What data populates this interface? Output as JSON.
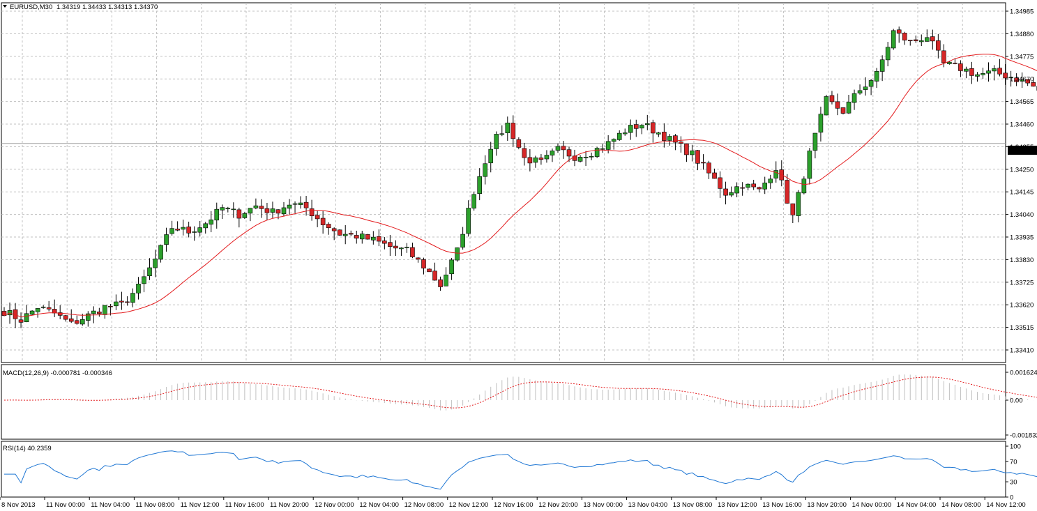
{
  "colors": {
    "background": "#ffffff",
    "grid": "#c0c0c0",
    "frame": "#000000",
    "bull_candle": "#2ca02c",
    "bear_candle": "#d62728",
    "wick": "#000000",
    "ma_line": "#e31a1c",
    "macd_hist": "#c0c0c0",
    "macd_signal": "#e31a1c",
    "rsi_line": "#1f77d4",
    "price_tag_bg": "#000000",
    "price_tag_text": "#ffffff"
  },
  "header": {
    "symbol": "EURUSD,M30",
    "ohlc": "1.34319 1.34433 1.34313 1.34370",
    "dropdown_icon": "triangle-down-icon"
  },
  "current_price_label": "1.34370",
  "chart_data": [
    {
      "type": "candlestick",
      "title": "EURUSD,M30",
      "ylim": [
        1.3341,
        1.34985
      ],
      "ytick_labels": [
        "1.34985",
        "1.34880",
        "1.34775",
        "1.34670",
        "1.34565",
        "1.34460",
        "1.34355",
        "1.34250",
        "1.34145",
        "1.34040",
        "1.33935",
        "1.33830",
        "1.33725",
        "1.33620",
        "1.33515",
        "1.33410"
      ],
      "current_price": 1.3437,
      "moving_average": "red overlay line",
      "grid": true
    },
    {
      "type": "bar",
      "title": "MACD(12,26,9) -0.000781 -0.000346",
      "ylim": [
        -0.001832,
        0.001624
      ],
      "ytick_labels": [
        "0.001624",
        "0.00",
        "-0.001832"
      ],
      "series": [
        {
          "kind": "histogram"
        },
        {
          "kind": "signal-dotted-line"
        }
      ]
    },
    {
      "type": "line",
      "title": "RSI(14) 40.2359",
      "ylim": [
        0,
        100
      ],
      "ytick_labels": [
        "100",
        "70",
        "30",
        "0"
      ],
      "levels": [
        70,
        30
      ]
    }
  ],
  "time_axis": {
    "labels": [
      "8 Nov 2013",
      "11 Nov 00:00",
      "11 Nov 04:00",
      "11 Nov 08:00",
      "11 Nov 12:00",
      "11 Nov 16:00",
      "11 Nov 20:00",
      "12 Nov 00:00",
      "12 Nov 04:00",
      "12 Nov 08:00",
      "12 Nov 12:00",
      "12 Nov 16:00",
      "12 Nov 20:00",
      "13 Nov 00:00",
      "13 Nov 04:00",
      "13 Nov 08:00",
      "13 Nov 12:00",
      "13 Nov 16:00",
      "13 Nov 20:00",
      "14 Nov 00:00",
      "14 Nov 04:00",
      "14 Nov 08:00",
      "14 Nov 12:00"
    ]
  },
  "price_anchors": [
    [
      0,
      1.3359
    ],
    [
      3,
      1.3355
    ],
    [
      6,
      1.3361
    ],
    [
      9,
      1.3358
    ],
    [
      12,
      1.3353
    ],
    [
      15,
      1.3357
    ],
    [
      18,
      1.3361
    ],
    [
      21,
      1.3362
    ],
    [
      24,
      1.337
    ],
    [
      27,
      1.3383
    ],
    [
      30,
      1.3398
    ],
    [
      33,
      1.3396
    ],
    [
      36,
      1.34
    ],
    [
      39,
      1.3407
    ],
    [
      42,
      1.3404
    ],
    [
      45,
      1.3408
    ],
    [
      48,
      1.3405
    ],
    [
      51,
      1.3409
    ],
    [
      54,
      1.3407
    ],
    [
      57,
      1.34
    ],
    [
      60,
      1.3395
    ],
    [
      63,
      1.3394
    ],
    [
      66,
      1.3392
    ],
    [
      69,
      1.3389
    ],
    [
      72,
      1.3387
    ],
    [
      75,
      1.338
    ],
    [
      78,
      1.3371
    ],
    [
      81,
      1.3387
    ],
    [
      84,
      1.3415
    ],
    [
      87,
      1.3436
    ],
    [
      90,
      1.3446
    ],
    [
      93,
      1.343
    ],
    [
      96,
      1.3428
    ],
    [
      99,
      1.3434
    ],
    [
      102,
      1.3431
    ],
    [
      105,
      1.3433
    ],
    [
      108,
      1.3437
    ],
    [
      111,
      1.3443
    ],
    [
      114,
      1.3446
    ],
    [
      117,
      1.3442
    ],
    [
      120,
      1.3437
    ],
    [
      123,
      1.3432
    ],
    [
      126,
      1.3423
    ],
    [
      129,
      1.3414
    ],
    [
      132,
      1.3418
    ],
    [
      135,
      1.3415
    ],
    [
      138,
      1.3426
    ],
    [
      141,
      1.3403
    ],
    [
      144,
      1.3432
    ],
    [
      147,
      1.3457
    ],
    [
      150,
      1.3452
    ],
    [
      153,
      1.3462
    ],
    [
      156,
      1.3469
    ],
    [
      159,
      1.3489
    ],
    [
      162,
      1.3484
    ],
    [
      165,
      1.3487
    ],
    [
      168,
      1.3474
    ],
    [
      171,
      1.3472
    ],
    [
      174,
      1.3469
    ],
    [
      177,
      1.347
    ],
    [
      180,
      1.3468
    ],
    [
      183,
      1.3465
    ],
    [
      186,
      1.346
    ],
    [
      189,
      1.3445
    ],
    [
      192,
      1.3427
    ],
    [
      195,
      1.3432
    ],
    [
      196,
      1.3437
    ]
  ]
}
